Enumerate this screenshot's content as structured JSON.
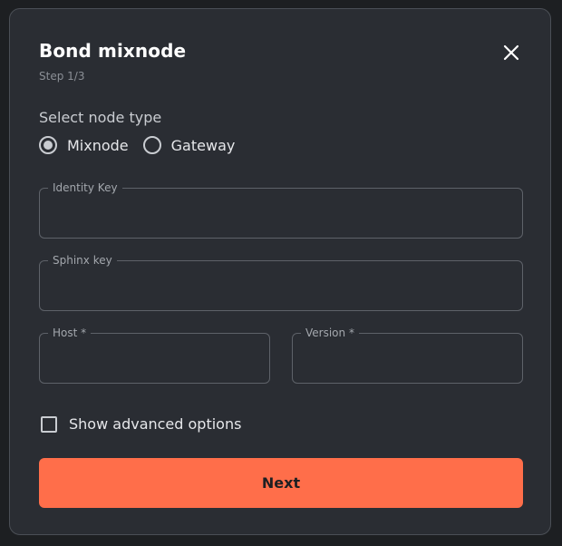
{
  "modal": {
    "title": "Bond mixnode",
    "step": "Step 1/3",
    "close_icon": "close-icon"
  },
  "node_type": {
    "label": "Select node type",
    "options": [
      {
        "label": "Mixnode",
        "selected": true
      },
      {
        "label": "Gateway",
        "selected": false
      }
    ]
  },
  "fields": {
    "identity_key": {
      "label": "Identity Key",
      "value": ""
    },
    "sphinx_key": {
      "label": "Sphinx key",
      "value": ""
    },
    "host": {
      "label": "Host *",
      "value": ""
    },
    "version": {
      "label": "Version *",
      "value": ""
    }
  },
  "advanced": {
    "label": "Show advanced options",
    "checked": false
  },
  "actions": {
    "next_label": "Next"
  },
  "colors": {
    "modal_bg": "#2a2d33",
    "accent": "#ff6e4a",
    "field_border": "#5e6269"
  }
}
